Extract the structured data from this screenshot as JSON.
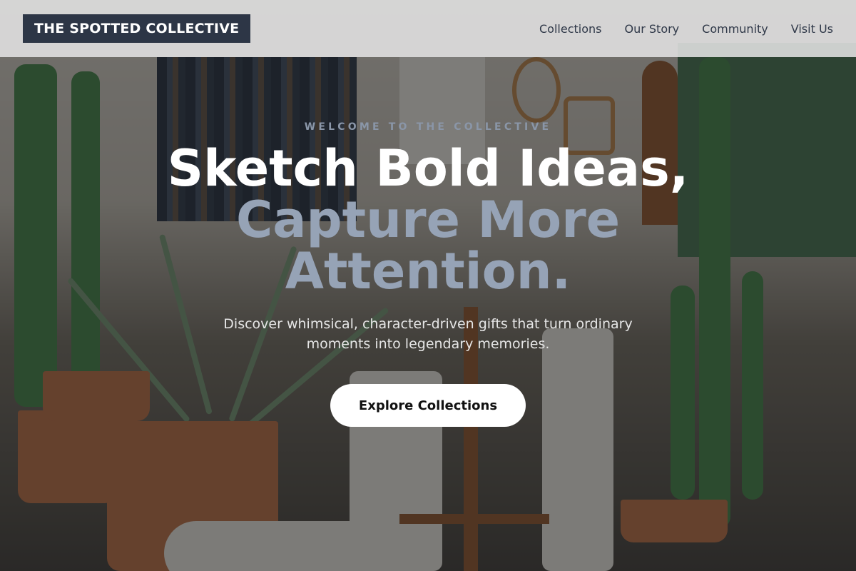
{
  "header": {
    "brand": "THE SPOTTED COLLECTIVE",
    "nav": [
      {
        "label": "Collections"
      },
      {
        "label": "Our Story"
      },
      {
        "label": "Community"
      },
      {
        "label": "Visit Us"
      }
    ]
  },
  "hero": {
    "eyebrow": "WELCOME TO THE COLLECTIVE",
    "headline_line1": "Sketch Bold Ideas,",
    "headline_line2": "Capture More",
    "headline_line3": "Attention.",
    "subtitle": "Discover whimsical, character-driven gifts that turn ordinary moments into legendary memories.",
    "cta_label": "Explore Collections"
  },
  "colors": {
    "brand_bg": "#2d3646",
    "accent_text": "#96a3b6",
    "cta_bg": "#ffffff"
  }
}
